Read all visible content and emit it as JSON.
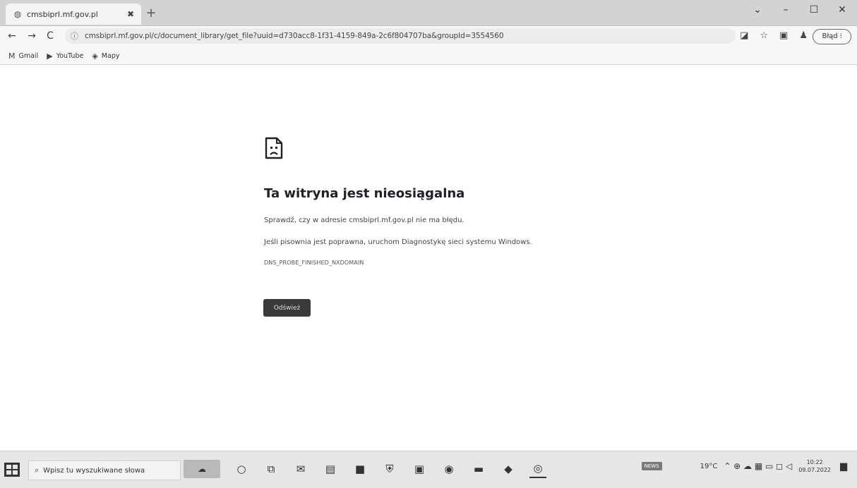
{
  "browser": {
    "tab": {
      "title": "cmsbiprl.mf.gov.pl",
      "favicon": "globe-icon",
      "close_glyph": "✖"
    },
    "newtab_glyph": "+",
    "window_controls": {
      "dropdown": "⌄",
      "minimize": "–",
      "maximize": "☐",
      "close": "✕"
    },
    "nav": {
      "back": "←",
      "forward": "→",
      "reload": "C"
    },
    "address": {
      "info_icon": "info-icon",
      "url": "cmsbiprl.mf.gov.pl/c/document_library/get_file?uuid=d730acc8-1f31-4159-849a-2c6f804707ba&groupId=3554560"
    },
    "toolbar_icons": {
      "translate": "◪",
      "star": "☆",
      "split": "▣",
      "profile": "♟"
    },
    "error_badge": "Błąd ⁝",
    "bookmarks": [
      {
        "label": "Gmail",
        "icon": "gmail-icon",
        "glyph": "M"
      },
      {
        "label": "YouTube",
        "icon": "youtube-icon",
        "glyph": "▶"
      },
      {
        "label": "Mapy",
        "icon": "maps-icon",
        "glyph": "◈"
      }
    ]
  },
  "error_page": {
    "icon": "sad-page-icon",
    "title": "Ta witryna jest nieosiągalna",
    "line1": "Sprawdź, czy w adresie cmsbiprl.mf.gov.pl nie ma błędu.",
    "line2": "Jeśli pisownia jest poprawna, uruchom Diagnostykę sieci systemu Windows.",
    "code": "DNS_PROBE_FINISHED_NXDOMAIN",
    "reload_label": "Odśwież"
  },
  "taskbar": {
    "search_placeholder": "Wpisz tu wyszukiwane słowa",
    "apps": [
      {
        "name": "cortana-icon",
        "glyph": "○"
      },
      {
        "name": "task-view-icon",
        "glyph": "⧉"
      },
      {
        "name": "mail-icon",
        "glyph": "✉"
      },
      {
        "name": "explorer-icon",
        "glyph": "▤"
      },
      {
        "name": "store-icon",
        "glyph": "■"
      },
      {
        "name": "shield-icon",
        "glyph": "⛨"
      },
      {
        "name": "office-icon",
        "glyph": "▣"
      },
      {
        "name": "edge-icon",
        "glyph": "◉"
      },
      {
        "name": "photos-icon",
        "glyph": "▬"
      },
      {
        "name": "settings-icon",
        "glyph": "◆"
      },
      {
        "name": "chrome-icon",
        "glyph": "◎"
      }
    ],
    "tray": {
      "news_badge": "NEWS",
      "temperature": "19°C",
      "symbols": "⌃ ⊕ ☁ ▦ ▭ ◻ ◁",
      "time": "10:22",
      "date": "09.07.2022",
      "notif_glyph": "▆"
    }
  }
}
